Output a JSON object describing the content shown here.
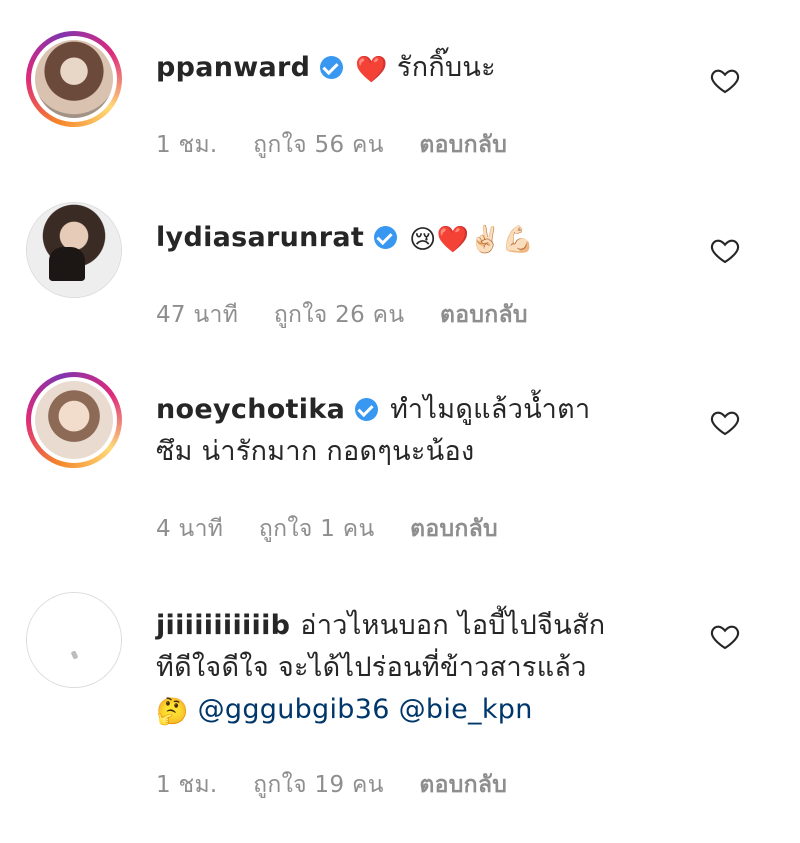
{
  "comments": [
    {
      "username": "ppanward",
      "verified": true,
      "emojis_before": "❤️",
      "text_lines": [
        "รักกิ๊บนะ"
      ],
      "time": "1 ชม.",
      "likes": "ถูกใจ 56 คน",
      "reply": "ตอบกลับ",
      "avatar_story_ring": true,
      "heart_icon": "heart-outline-icon"
    },
    {
      "username": "lydiasarunrat",
      "verified": true,
      "emojis": "😢❤️✌🏻💪🏻",
      "time": "47 นาที",
      "likes": "ถูกใจ 26 คน",
      "reply": "ตอบกลับ",
      "avatar_story_ring": false,
      "heart_icon": "heart-outline-icon"
    },
    {
      "username": "noeychotika",
      "verified": true,
      "text_lines": [
        "ทำไมดูแล้วน้ำตา",
        "ซึม น่ารักมาก กอดๆนะน้อง"
      ],
      "time": "4 นาที",
      "likes": "ถูกใจ 1 คน",
      "reply": "ตอบกลับ",
      "avatar_story_ring": true,
      "heart_icon": "heart-outline-icon"
    },
    {
      "username": "jiiiiiiiiiiib",
      "verified": false,
      "text_lines": [
        "อ่าวไหนบอก ไอบี้ไปจีนสัก",
        "ทีดีใจดีใจ จะได้ไปร่อนที่ข้าวสารแล้ว"
      ],
      "emoji_line3": "🤔",
      "mentions": [
        "@gggubgib36",
        "@bie_kpn"
      ],
      "time": "1 ชม.",
      "likes": "ถูกใจ 19 คน",
      "reply": "ตอบกลับ",
      "avatar_story_ring": false,
      "heart_icon": "heart-outline-icon"
    }
  ],
  "colors": {
    "text": "#262626",
    "meta": "#8e8e8e",
    "verified": "#3897f0",
    "mention": "#00376b"
  }
}
